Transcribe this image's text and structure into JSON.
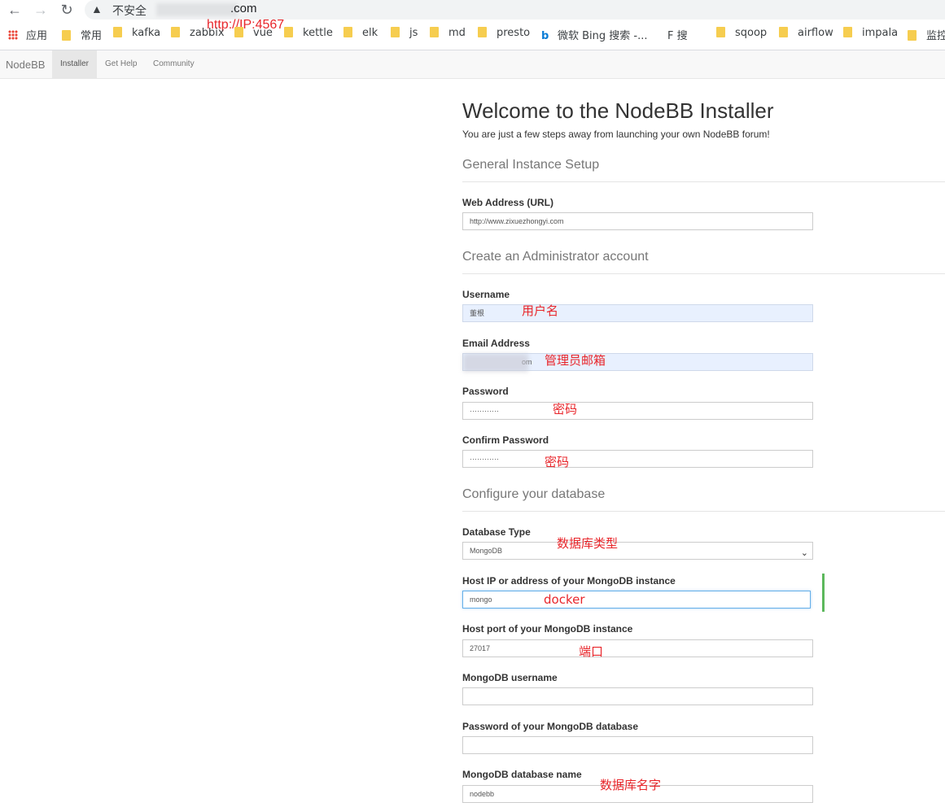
{
  "browser": {
    "insecure_label": "不安全",
    "url_tail": ".com",
    "annotation": "http://IP:4567",
    "bookmarks": [
      "应用",
      "常用",
      "kafka",
      "zabbix",
      "vue",
      "kettle",
      "elk",
      "js",
      "md",
      "presto",
      "微软 Bing 搜索 -...",
      "F 搜",
      "sqoop",
      "airflow",
      "impala",
      "监控"
    ]
  },
  "nav": {
    "brand": "NodeBB",
    "tabs": [
      "Installer",
      "Get Help",
      "Community"
    ]
  },
  "page": {
    "title": "Welcome to the NodeBB Installer",
    "lead": "You are just a few steps away from launching your own NodeBB forum!",
    "sections": [
      "General Instance Setup",
      "Create an Administrator account",
      "Configure your database"
    ]
  },
  "fields": {
    "url": {
      "label": "Web Address (URL)",
      "value": "http://www.zixuezhongyi.com"
    },
    "username": {
      "label": "Username",
      "value": "董根",
      "note": "用户名"
    },
    "email": {
      "label": "Email Address",
      "value": "om",
      "note": "管理员邮箱"
    },
    "password": {
      "label": "Password",
      "value": "············",
      "note": "密码"
    },
    "confirm": {
      "label": "Confirm Password",
      "value": "············",
      "note": "密码"
    },
    "db_type": {
      "label": "Database Type",
      "value": "MongoDB",
      "note": "数据库类型"
    },
    "host": {
      "label": "Host IP or address of your MongoDB instance",
      "value": "mongo",
      "note": "docker"
    },
    "port": {
      "label": "Host port of your MongoDB instance",
      "value": "27017",
      "note": "端口"
    },
    "db_user": {
      "label": "MongoDB username",
      "value": ""
    },
    "db_pass": {
      "label": "Password of your MongoDB database",
      "value": ""
    },
    "db_name": {
      "label": "MongoDB database name",
      "value": "nodebb",
      "note": "数据库名字"
    }
  }
}
